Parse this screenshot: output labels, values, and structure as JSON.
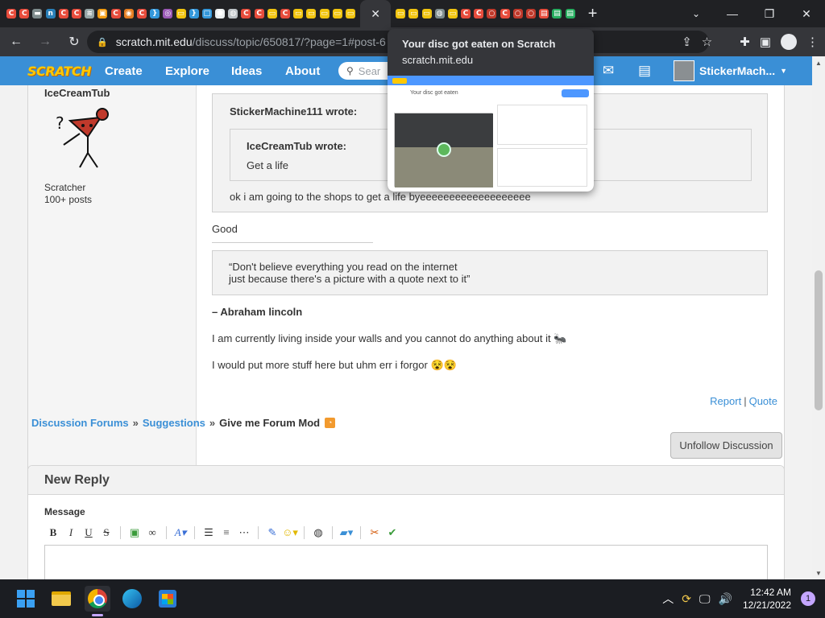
{
  "browser": {
    "tab_favicons": [
      {
        "glyph": "C",
        "color": "#e74c3c"
      },
      {
        "glyph": "C",
        "color": "#e74c3c"
      },
      {
        "glyph": "▬",
        "color": "#7f8c8d"
      },
      {
        "glyph": "n",
        "color": "#2980b9"
      },
      {
        "glyph": "C",
        "color": "#e74c3c"
      },
      {
        "glyph": "C",
        "color": "#e74c3c"
      },
      {
        "glyph": "≋",
        "color": "#95a5a6"
      },
      {
        "glyph": "▣",
        "color": "#f39c12"
      },
      {
        "glyph": "C",
        "color": "#e74c3c"
      },
      {
        "glyph": "◉",
        "color": "#e67e22"
      },
      {
        "glyph": "C",
        "color": "#e74c3c"
      },
      {
        "glyph": "}",
        "color": "#3498db"
      },
      {
        "glyph": "◎",
        "color": "#9b59b6"
      },
      {
        "glyph": "▭",
        "color": "#f1c40f"
      },
      {
        "glyph": "}",
        "color": "#3498db"
      },
      {
        "glyph": "□",
        "color": "#3498db"
      },
      {
        "glyph": "⬟",
        "color": "#ecf0f1"
      },
      {
        "glyph": "◍",
        "color": "#bdc3c7"
      },
      {
        "glyph": "C",
        "color": "#e74c3c"
      },
      {
        "glyph": "C",
        "color": "#e74c3c"
      },
      {
        "glyph": "▭",
        "color": "#f1c40f"
      },
      {
        "glyph": "C",
        "color": "#e74c3c"
      },
      {
        "glyph": "▭",
        "color": "#f1c40f"
      },
      {
        "glyph": "▭",
        "color": "#f1c40f"
      },
      {
        "glyph": "▭",
        "color": "#f1c40f"
      },
      {
        "glyph": "▭",
        "color": "#f1c40f"
      },
      {
        "glyph": "▭",
        "color": "#f1c40f"
      }
    ],
    "tab_favicons_after": [
      {
        "glyph": "▭",
        "color": "#f1c40f"
      },
      {
        "glyph": "▭",
        "color": "#f1c40f"
      },
      {
        "glyph": "▭",
        "color": "#f1c40f"
      },
      {
        "glyph": "◍",
        "color": "#7f8c8d"
      },
      {
        "glyph": "▭",
        "color": "#f1c40f"
      },
      {
        "glyph": "C",
        "color": "#e74c3c"
      },
      {
        "glyph": "C",
        "color": "#e74c3c"
      },
      {
        "glyph": "○",
        "color": "#c0392b"
      },
      {
        "glyph": "C",
        "color": "#e74c3c"
      },
      {
        "glyph": "○",
        "color": "#c0392b"
      },
      {
        "glyph": "○",
        "color": "#c0392b"
      },
      {
        "glyph": "▤",
        "color": "#e74c3c"
      },
      {
        "glyph": "▤",
        "color": "#27ae60"
      },
      {
        "glyph": "▤",
        "color": "#27ae60"
      }
    ],
    "url_host": "scratch.mit.edu",
    "url_path": "/discuss/topic/650817/?page=1#post-6",
    "hover_card": {
      "title": "Your disc got eaten on Scratch",
      "domain": "scratch.mit.edu",
      "preview_title": "Your disc got eaten"
    }
  },
  "scratch_nav": {
    "logo": "SCRATCH",
    "links": [
      "Create",
      "Explore",
      "Ideas",
      "About"
    ],
    "search_placeholder": "Sear",
    "username": "StickerMach..."
  },
  "post": {
    "author": "IceCreamTub",
    "rank": "Scratcher",
    "post_count": "100+ posts",
    "outer_quote_author": "StickerMachine111 wrote:",
    "inner_quote_author": "IceCreamTub wrote:",
    "inner_quote_text": "Get a life",
    "outer_quote_text": "ok i am going to the shops to get a life byeeeeeeeeeeeeeeeeeee",
    "reply_text": "Good",
    "sig_quote_line1": "“Don't believe everything you read on the internet",
    "sig_quote_line2": "just because there's a picture with a quote next to it”",
    "sig_attribution": "– Abraham lincoln",
    "sig_line1": "I am currently living inside your walls and you cannot do anything about it 🐜",
    "sig_line2": "I would put more stuff here but uhm err i forgor 😵😵",
    "report": "Report",
    "quote": "Quote",
    "action_sep": "|"
  },
  "breadcrumb": {
    "forums": "Discussion Forums",
    "suggestions": "Suggestions",
    "topic": "Give me Forum Mod",
    "sep": "»"
  },
  "unfollow_label": "Unfollow Discussion",
  "reply": {
    "heading": "New Reply",
    "message_label": "Message"
  },
  "taskbar": {
    "time": "12:42 AM",
    "date": "12/21/2022",
    "notifications": "1"
  }
}
